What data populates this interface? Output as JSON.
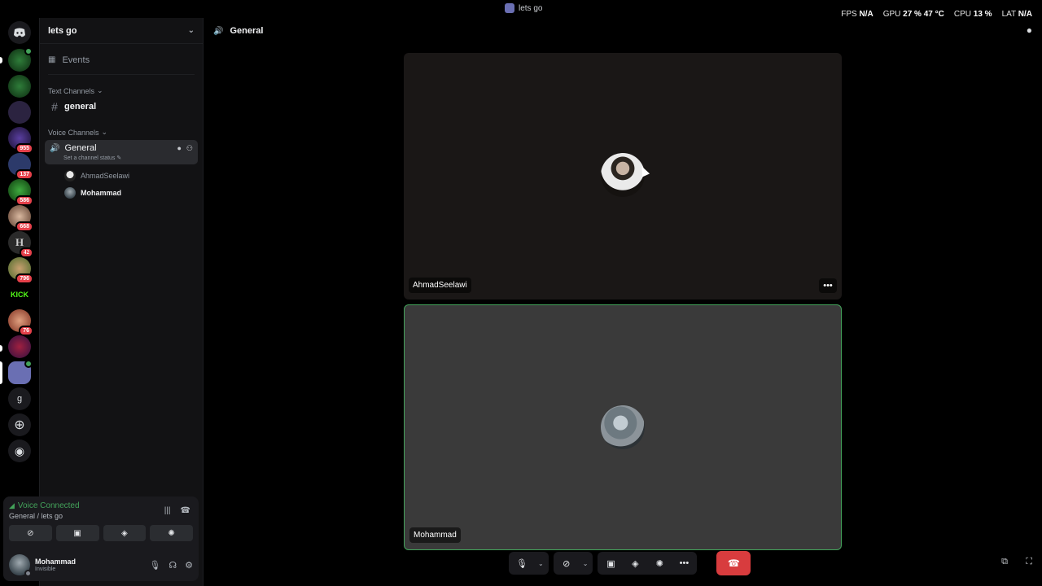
{
  "window": {
    "title": "lets go"
  },
  "overlay": {
    "fps_label": "FPS",
    "fps_value": "N/A",
    "gpu_label": "GPU",
    "gpu_value": "27 %",
    "gpu_temp": "47 °C",
    "cpu_label": "CPU",
    "cpu_value": "13 %",
    "lat_label": "LAT",
    "lat_value": "N/A"
  },
  "servers": [
    {
      "id": "discord-home",
      "badge": ""
    },
    {
      "id": "server-1",
      "badge": ""
    },
    {
      "id": "server-2",
      "badge": ""
    },
    {
      "id": "server-3",
      "badge": ""
    },
    {
      "id": "server-4",
      "badge": "955"
    },
    {
      "id": "server-5",
      "badge": "137"
    },
    {
      "id": "server-6",
      "badge": "586"
    },
    {
      "id": "server-7",
      "badge": "668"
    },
    {
      "id": "server-8",
      "badge": "42"
    },
    {
      "id": "server-9",
      "badge": "796"
    },
    {
      "id": "server-kick",
      "label": "KICK",
      "badge": ""
    },
    {
      "id": "server-10",
      "badge": "76"
    },
    {
      "id": "server-11",
      "badge": ""
    },
    {
      "id": "server-12",
      "badge": ""
    },
    {
      "id": "server-g",
      "label": "g",
      "badge": ""
    }
  ],
  "sidebar": {
    "server_name": "lets go",
    "events_label": "Events",
    "text_category": "Text Channels",
    "text_channel": "general",
    "voice_category": "Voice Channels",
    "voice_channel": "General",
    "voice_status": "Set a channel status",
    "members": [
      "AhmadSeelawi",
      "Mohammad"
    ]
  },
  "voice_panel": {
    "status": "Voice Connected",
    "location": "General / lets go"
  },
  "user_panel": {
    "name": "Mohammad",
    "status": "Invisible"
  },
  "main": {
    "channel_title": "General",
    "tiles": [
      {
        "name": "AhmadSeelawi"
      },
      {
        "name": "Mohammad"
      }
    ]
  },
  "colors": {
    "accent_green": "#43a25a",
    "end_call_red": "#d83c3e",
    "badge_red": "#e5404a"
  }
}
